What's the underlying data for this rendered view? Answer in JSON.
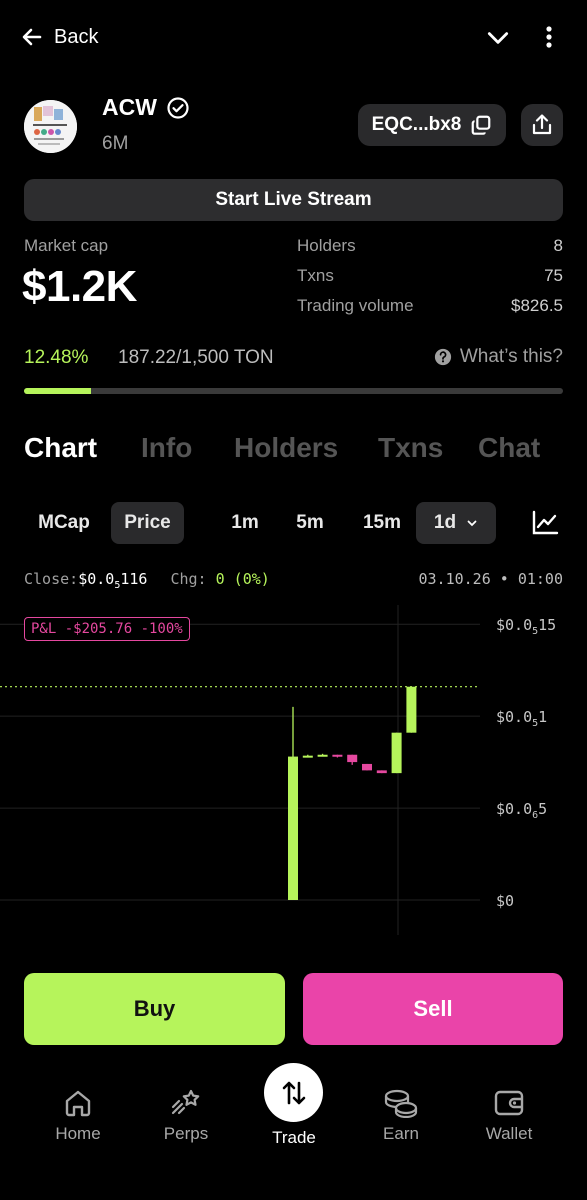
{
  "topbar": {
    "back_label": "Back"
  },
  "token": {
    "name": "ACW",
    "age": "6M",
    "address": "EQC...bx8",
    "live_label": "Start Live Stream"
  },
  "stats": {
    "market_cap_label": "Market cap",
    "market_cap_value": "$1.2K",
    "holders_label": "Holders",
    "holders_value": "8",
    "txns_label": "Txns",
    "txns_value": "75",
    "volume_label": "Trading volume",
    "volume_value": "$826.5"
  },
  "progress": {
    "percent_label": "12.48%",
    "amount_label": "187.22/1,500 TON",
    "fraction": 0.1248,
    "help_label": "What’s this?"
  },
  "tabs": [
    "Chart",
    "Info",
    "Holders",
    "Txns",
    "Chat"
  ],
  "chart_controls": {
    "mcap": "MCap",
    "price": "Price",
    "intervals": [
      "1m",
      "5m",
      "15m",
      "1d"
    ],
    "selected_interval": "1d"
  },
  "close_row": {
    "close_label": "Close:",
    "close_value": "$0.0",
    "close_sub": "5",
    "close_tail": "116",
    "chg_label": "Chg:",
    "chg_value": "0 (0%)",
    "datetime": "03.10.26 • 01:00"
  },
  "pnl_label": "P&L -$205.76 -100%",
  "chart_data": {
    "type": "candlestick",
    "y_tick_labels": [
      {
        "main": "$0.0",
        "sub": "5",
        "tail": "15",
        "value": 15
      },
      {
        "main": "$0.0",
        "sub": "5",
        "tail": "1",
        "value": 10
      },
      {
        "main": "$0.0",
        "sub": "6",
        "tail": "5",
        "value": 5
      },
      {
        "main": "$0",
        "sub": "",
        "tail": "",
        "value": 0
      }
    ],
    "ylim": [
      0,
      15.5
    ],
    "last_price_line": 11.6,
    "candles": [
      {
        "open": 0,
        "close": 7.8,
        "high": 10.5,
        "low": 0,
        "dir": "up"
      },
      {
        "open": 7.8,
        "close": 7.85,
        "high": 7.9,
        "low": 7.8,
        "dir": "up"
      },
      {
        "open": 7.85,
        "close": 7.9,
        "high": 7.95,
        "low": 7.85,
        "dir": "up"
      },
      {
        "open": 7.9,
        "close": 7.8,
        "high": 7.9,
        "low": 7.75,
        "dir": "down"
      },
      {
        "open": 7.9,
        "close": 7.5,
        "high": 7.9,
        "low": 7.35,
        "dir": "down"
      },
      {
        "open": 7.4,
        "close": 7.05,
        "high": 7.4,
        "low": 7.05,
        "dir": "down"
      },
      {
        "open": 7.05,
        "close": 6.9,
        "high": 7.05,
        "low": 6.9,
        "dir": "down"
      },
      {
        "open": 6.9,
        "close": 9.1,
        "high": 9.1,
        "low": 6.9,
        "dir": "up"
      },
      {
        "open": 9.1,
        "close": 11.6,
        "high": 11.6,
        "low": 9.1,
        "dir": "up"
      }
    ],
    "colors": {
      "up": "#b6f45b",
      "down": "#e5489f",
      "grid": "#222222"
    }
  },
  "actions": {
    "buy": "Buy",
    "sell": "Sell"
  },
  "nav": [
    "Home",
    "Perps",
    "Trade",
    "Earn",
    "Wallet"
  ]
}
